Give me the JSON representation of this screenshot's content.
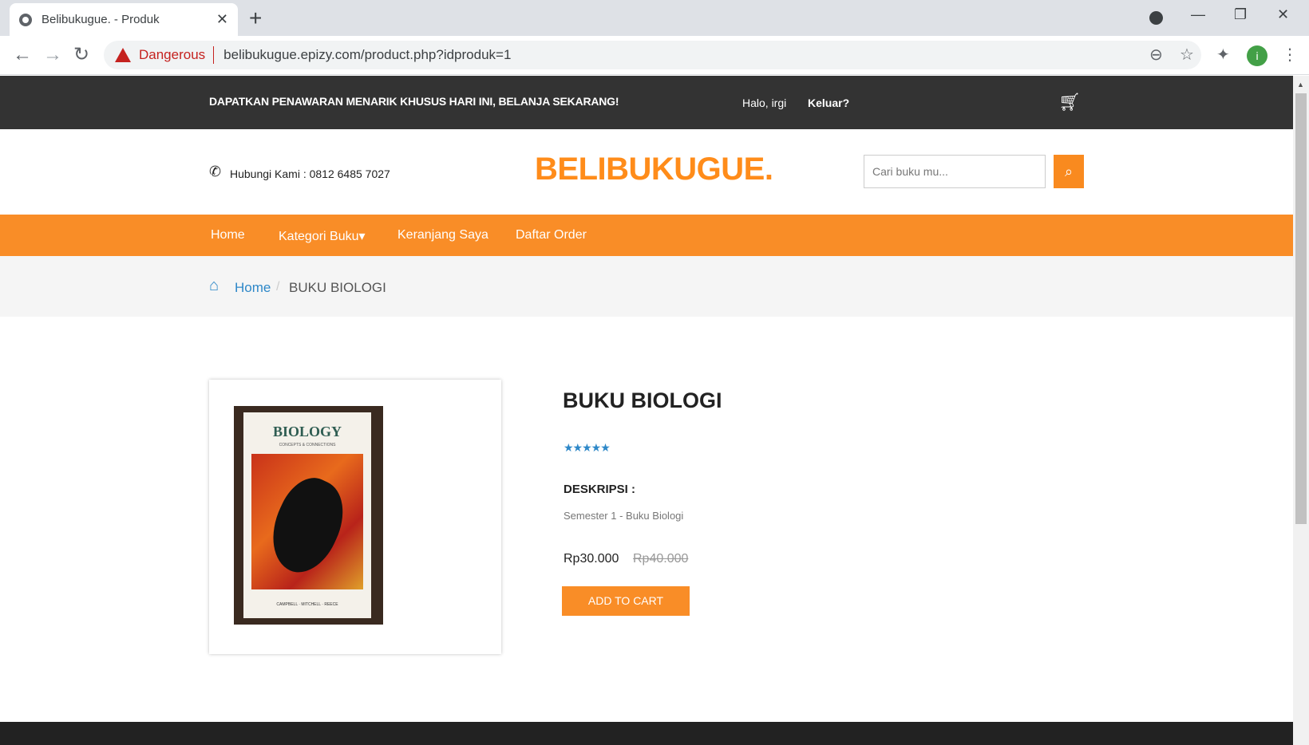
{
  "browser": {
    "tab_title": "Belibukugue. - Produk",
    "security_label": "Dangerous",
    "url": "belibukugue.epizy.com/product.php?idproduk=1",
    "avatar_letter": "i"
  },
  "topbar": {
    "promo": "DAPATKAN PENAWARAN MENARIK KHUSUS HARI INI, BELANJA SEKARANG!",
    "greeting": "Halo, irgi",
    "logout": "Keluar?"
  },
  "header": {
    "phone": "Hubungi Kami : 0812 6485 7027",
    "logo": "BELIBUKUGUE.",
    "search_placeholder": "Cari buku mu..."
  },
  "menu": {
    "items": [
      "Home",
      "Kategori Buku▾",
      "Keranjang Saya",
      "Daftar Order"
    ]
  },
  "breadcrumb": {
    "home": "Home",
    "separator": "/",
    "current": "BUKU BIOLOGI"
  },
  "product": {
    "title": "BUKU BIOLOGI",
    "rating_stars": 5,
    "stars_text": "★★★★★",
    "description_label": "DESKRIPSI :",
    "description": "Semester 1 - Buku Biologi",
    "price": "Rp30.000",
    "old_price": "Rp40.000",
    "add_to_cart": "ADD TO CART",
    "cover_title": "BIOLOGY",
    "cover_subtitle": "CONCEPTS & CONNECTIONS",
    "cover_authors": "CAMPBELL · MITCHELL · REECE"
  },
  "colors": {
    "accent": "#f98d27",
    "link": "#2e88c8",
    "topbar": "#333333"
  }
}
